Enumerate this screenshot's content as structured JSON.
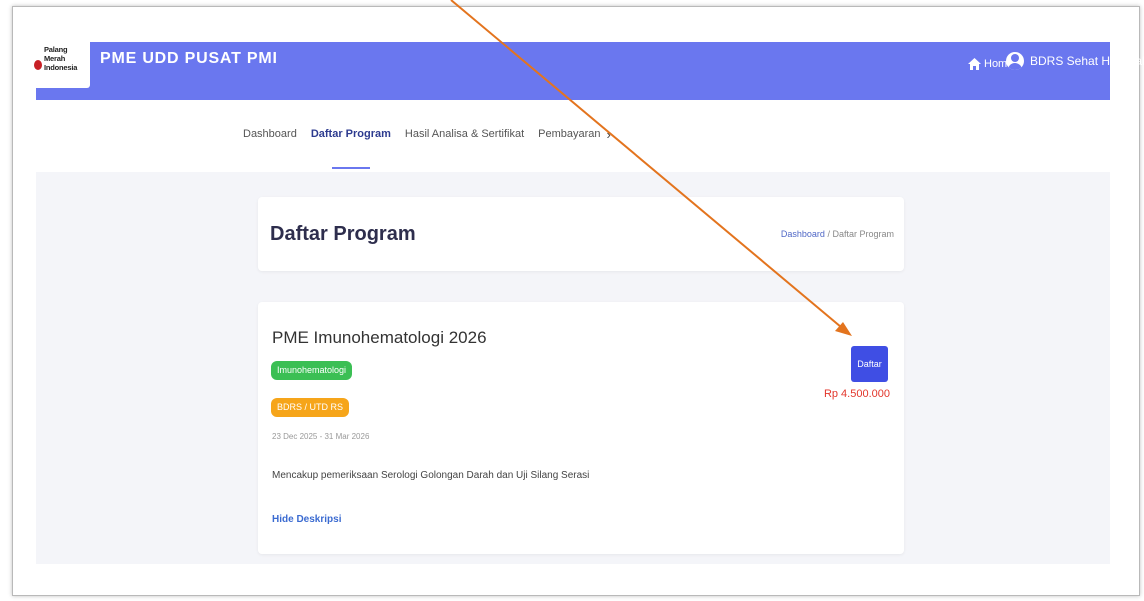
{
  "header": {
    "logo_text": [
      "Palang",
      "Merah",
      "Indonesia"
    ],
    "brand": "PME UDD PUSAT PMI",
    "home_label": "Home",
    "user_name": "BDRS Sehat Hospital"
  },
  "nav": {
    "tabs": [
      {
        "label": "Dashboard",
        "active": false
      },
      {
        "label": "Daftar Program",
        "active": true
      },
      {
        "label": "Hasil Analisa & Sertifikat",
        "active": false
      },
      {
        "label": "Pembayaran",
        "active": false
      }
    ],
    "more_icon": "chevron-right-icon"
  },
  "page": {
    "title": "Daftar Program",
    "breadcrumb": {
      "root": "Dashboard",
      "separator": "/",
      "current": "Daftar Program"
    }
  },
  "program": {
    "title": "PME Imunohematologi 2026",
    "badges": [
      {
        "label": "Imunohematologi",
        "color": "#3bbf54"
      },
      {
        "label": "BDRS / UTD RS",
        "color": "#f6a51a"
      }
    ],
    "dates": "23 Dec 2025 - 31 Mar 2026",
    "description": "Mencakup pemeriksaan Serologi Golongan Darah dan Uji Silang Serasi",
    "hide_link": "Hide Deskripsi",
    "register_button": "Daftar",
    "price": "Rp 4.500.000"
  },
  "colors": {
    "header": "#6a77ef",
    "button": "#3f4ee4",
    "price": "#e2362b",
    "annotation_arrow": "#e3741e"
  }
}
